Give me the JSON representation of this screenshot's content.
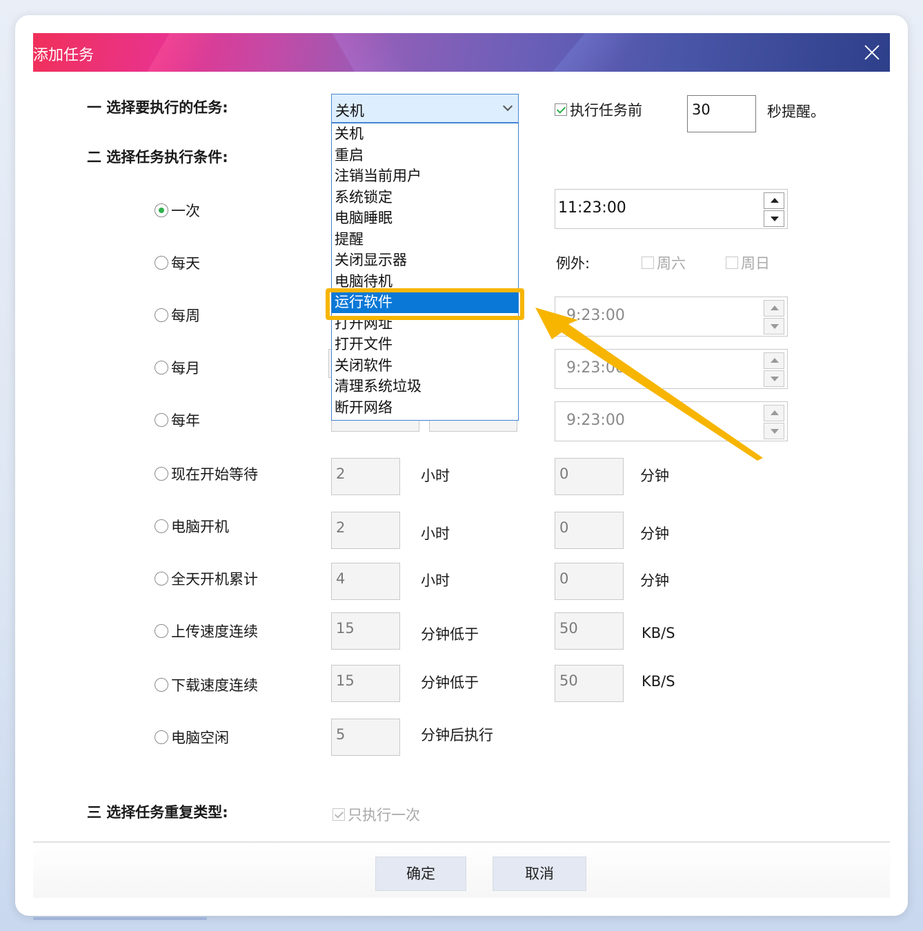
{
  "dialog": {
    "title": "添加任务"
  },
  "task": {
    "section_label": "一 选择要执行的任务:",
    "selected": "关机",
    "options": [
      "关机",
      "重启",
      "注销当前用户",
      "系统锁定",
      "电脑睡眠",
      "提醒",
      "关闭显示器",
      "电脑待机",
      "运行软件",
      "打开网址",
      "打开文件",
      "关闭软件",
      "清理系统垃圾",
      "断开网络"
    ],
    "highlighted_option": "运行软件",
    "remind_label": "执行任务前",
    "remind_value": "30",
    "remind_suffix": "秒提醒。"
  },
  "conditions": {
    "section_label": "二 选择任务执行条件:",
    "once": {
      "label": "一次",
      "time": "11:23:00"
    },
    "daily": {
      "label": "每天",
      "exception_label": "例外:",
      "saturday": "周六",
      "sunday": "周日"
    },
    "weekly": {
      "label": "每周",
      "time": "9:23:00"
    },
    "monthly": {
      "label": "每月",
      "time": "9:23:00"
    },
    "yearly": {
      "label": "每年",
      "time": "9:23:00"
    },
    "wait": {
      "label": "现在开始等待",
      "hours": "2",
      "hours_unit": "小时",
      "minutes": "0",
      "minutes_unit": "分钟"
    },
    "boot": {
      "label": "电脑开机",
      "hours": "2",
      "hours_unit": "小时",
      "minutes": "0",
      "minutes_unit": "分钟"
    },
    "cumulative": {
      "label": "全天开机累计",
      "hours": "4",
      "hours_unit": "小时",
      "minutes": "0",
      "minutes_unit": "分钟"
    },
    "upload": {
      "label": "上传速度连续",
      "minutes": "15",
      "minutes_unit": "分钟低于",
      "speed": "50",
      "speed_unit": "KB/S"
    },
    "download": {
      "label": "下载速度连续",
      "minutes": "15",
      "minutes_unit": "分钟低于",
      "speed": "50",
      "speed_unit": "KB/S"
    },
    "idle": {
      "label": "电脑空闲",
      "minutes": "5",
      "minutes_unit": "分钟后执行"
    }
  },
  "repeat": {
    "section_label": "三 选择任务重复类型:",
    "once_only": "只执行一次"
  },
  "buttons": {
    "ok": "确定",
    "cancel": "取消"
  },
  "colors": {
    "accent": "#0a78d7",
    "highlight": "#f7b500",
    "check_green": "#2eb04c"
  }
}
